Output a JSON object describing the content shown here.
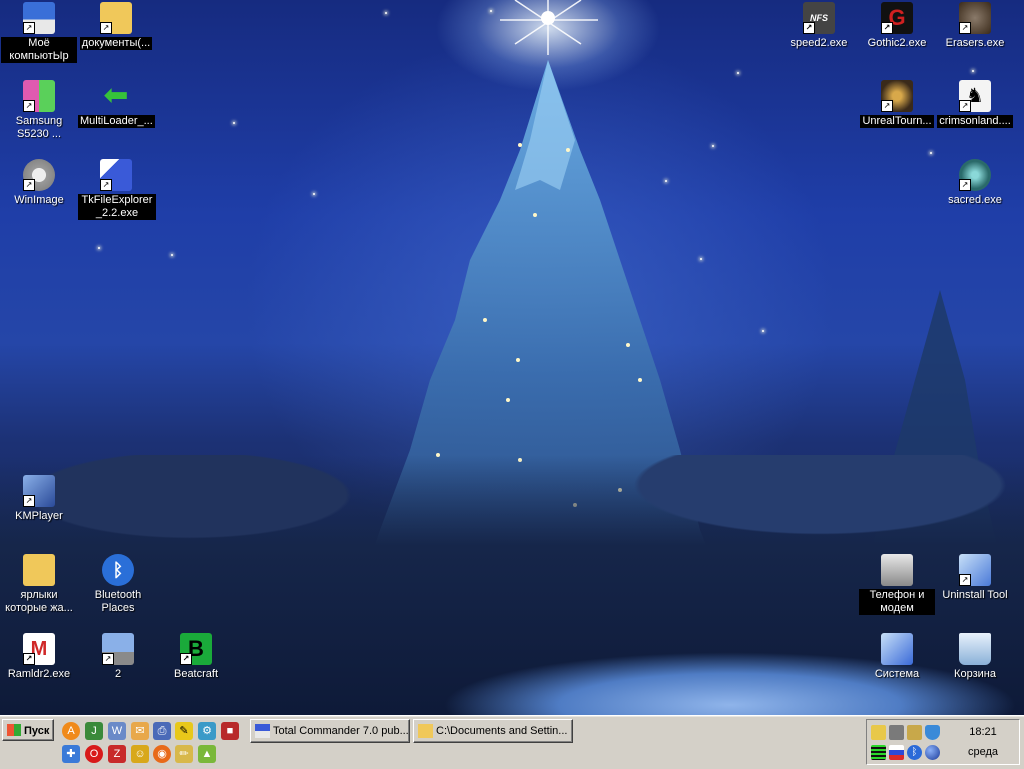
{
  "desktop_icons": [
    {
      "id": "my-computer",
      "label": "Моё компьютЫр",
      "selected": true,
      "icon": "floppy-icon",
      "color": "#3a6fd8"
    },
    {
      "id": "documents",
      "label": "документы(...",
      "selected": true,
      "icon": "folder-icon",
      "color": "#f0c85a"
    },
    {
      "id": "samsung",
      "label": "Samsung S5230 ...",
      "selected": false,
      "icon": "samsung-apps-icon",
      "color": "#e05ab0"
    },
    {
      "id": "multiloader",
      "label": "MultiLoader_...",
      "selected": true,
      "icon": "green-arrow-icon",
      "color": "#36c23a"
    },
    {
      "id": "winimage",
      "label": "WinImage",
      "selected": false,
      "icon": "disk-image-icon",
      "color": "#c0c0c0"
    },
    {
      "id": "tkfileexplorer",
      "label": "TkFileExplorer_2.2.exe",
      "selected": true,
      "icon": "file-explorer-icon",
      "color": "#3a5ad8"
    },
    {
      "id": "speed2",
      "label": "speed2.exe",
      "selected": false,
      "icon": "nfs-icon",
      "color": "#444444"
    },
    {
      "id": "gothic2",
      "label": "Gothic2.exe",
      "selected": false,
      "icon": "gothic-icon",
      "color": "#c02020"
    },
    {
      "id": "erasers",
      "label": "Erasers.exe",
      "selected": false,
      "icon": "erasers-icon",
      "color": "#6a5a4a"
    },
    {
      "id": "unrealtourn",
      "label": "UnrealTourn...",
      "selected": true,
      "icon": "unreal-icon",
      "color": "#8a6a2a"
    },
    {
      "id": "crimsonland",
      "label": "crimsonland....",
      "selected": true,
      "icon": "crimsonland-icon",
      "color": "#f4f4f4"
    },
    {
      "id": "sacred",
      "label": "sacred.exe",
      "selected": false,
      "icon": "sacred-icon",
      "color": "#3a8a8a"
    },
    {
      "id": "kmplayer",
      "label": "KMPlayer",
      "selected": false,
      "icon": "kmplayer-icon",
      "color": "#4a6ab8"
    },
    {
      "id": "shortcuts-folder",
      "label": "ярлыки которые жа...",
      "selected": false,
      "icon": "folder-icon",
      "color": "#f0c85a"
    },
    {
      "id": "bluetooth-places",
      "label": "Bluetooth Places",
      "selected": false,
      "icon": "bluetooth-icon",
      "color": "#2a6fd8"
    },
    {
      "id": "ramldr2",
      "label": "Ramldr2.exe",
      "selected": false,
      "icon": "motorola-icon",
      "color": "#d02828"
    },
    {
      "id": "network-2",
      "label": "2",
      "selected": false,
      "icon": "network-computer-icon",
      "color": "#4a7ad8"
    },
    {
      "id": "beatcraft",
      "label": "Beatcraft",
      "selected": false,
      "icon": "beatcraft-icon",
      "color": "#1aaa3a"
    },
    {
      "id": "phone-modem",
      "label": "Телефон и модем",
      "selected": true,
      "icon": "phone-icon",
      "color": "#b8b8b8"
    },
    {
      "id": "uninstall-tool",
      "label": "Uninstall Tool",
      "selected": false,
      "icon": "uninstall-icon",
      "color": "#6a9ad8"
    },
    {
      "id": "system",
      "label": "Система",
      "selected": false,
      "icon": "system-icon",
      "color": "#4a8ad8"
    },
    {
      "id": "recycle-bin",
      "label": "Корзина",
      "selected": false,
      "icon": "recycle-bin-icon",
      "color": "#a8c8e8"
    }
  ],
  "taskbar": {
    "start_label": "Пуск",
    "quick_launch": [
      {
        "icon": "avast-icon",
        "color": "#f08a1a"
      },
      {
        "icon": "java-icon",
        "color": "#3a8a3a"
      },
      {
        "icon": "winamp-icon",
        "color": "#6a8ac8"
      },
      {
        "icon": "chat-icon",
        "color": "#e8a84a"
      },
      {
        "icon": "printer-icon",
        "color": "#4a6ab8"
      },
      {
        "icon": "paint-icon",
        "color": "#e8c81a"
      },
      {
        "icon": "network-tool-icon",
        "color": "#3a9ac8"
      },
      {
        "icon": "stop-icon",
        "color": "#b82a2a"
      },
      {
        "icon": "puzzle-icon",
        "color": "#3a7ad8"
      },
      {
        "icon": "opera-icon",
        "color": "#d81a1a"
      },
      {
        "icon": "filezilla-icon",
        "color": "#c82a2a"
      },
      {
        "icon": "people-icon",
        "color": "#d8a81a"
      },
      {
        "icon": "firefox-icon",
        "color": "#e86a1a"
      },
      {
        "icon": "pencil-icon",
        "color": "#d8b84a"
      },
      {
        "icon": "android-icon",
        "color": "#7ab83a"
      }
    ],
    "tasks": [
      {
        "label": "Total Commander 7.0 pub...",
        "icon": "total-commander-icon"
      },
      {
        "label": "C:\\Documents and Settin...",
        "icon": "folder-icon"
      }
    ],
    "tray": {
      "time": "18:21",
      "day": "среда",
      "icons": [
        {
          "icon": "tray-app-icon",
          "color": "#e8c84a"
        },
        {
          "icon": "tray-network-icon",
          "color": "#7a7a7a"
        },
        {
          "icon": "tray-monitor-icon",
          "color": "#c8a84a"
        },
        {
          "icon": "shield-icon",
          "color": "#3a8ad8"
        },
        {
          "icon": "signal-icon",
          "color": "#2ad82a"
        },
        {
          "icon": "language-flag-icon",
          "color": "#d82a2a"
        },
        {
          "icon": "bluetooth-tray-icon",
          "color": "#2a6ad8"
        },
        {
          "icon": "globe-icon",
          "color": "#3a5ab8"
        }
      ]
    }
  }
}
